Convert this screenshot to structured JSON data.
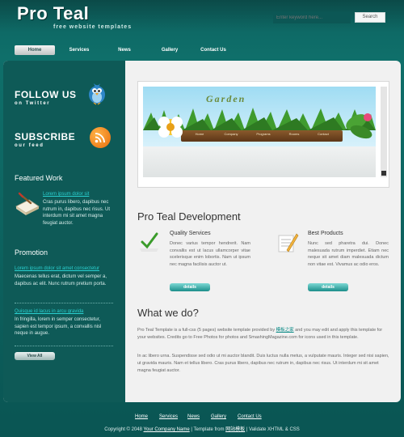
{
  "logo": {
    "title": "Pro Teal",
    "subtitle": "free website templates"
  },
  "search": {
    "placeholder": "Enter keyword here...",
    "button_label": "Search"
  },
  "nav": {
    "items": [
      "Home",
      "Services",
      "News",
      "Gallery",
      "Contact Us"
    ],
    "active": 0
  },
  "sidebar": {
    "twitter": {
      "title": "FOLLOW US",
      "subtitle": "on Twitter",
      "icon": "twitter-bird-icon"
    },
    "rss": {
      "title": "SUBSCRIBE",
      "subtitle": "our feed",
      "icon": "rss-icon"
    },
    "featured": {
      "title": "Featured Work",
      "link": "Lorem ipsum dolor sit",
      "text": "Cras purus libero, dapibus nec rutrum in, dapibus nec risus. Ut interdum mi sit amet magna feugiat auctor."
    },
    "promotion": {
      "title": "Promotion",
      "items": [
        {
          "link": "Lorem ipsum dolor sit amet consectetur",
          "text": "Maecenas tellus erat, dictum vel semper a, dapibus ac elit. Nunc rutrum pretium porta."
        },
        {
          "link": "Quisque id lacus in arcu gravida",
          "text": "In fringilla, lorem in semper consectetur, sapien est tempor ipsum, a convallis nisl neque in augue."
        }
      ],
      "view_all_label": "View All"
    }
  },
  "banner": {
    "word": "Garden",
    "menu": [
      "Home",
      "Company",
      "Programs",
      "Rooms",
      "Contact"
    ]
  },
  "main": {
    "heading": "Pro Teal Development",
    "features": [
      {
        "title": "Quality Services",
        "text": "Donec varius tempor hendrerit. Nam convallis est ut lacus ullamcorper vitae scelerisque enim lobortis. Nam ut ipsum nec magna facilisis auctor ut.",
        "button": "details"
      },
      {
        "title": "Best Products",
        "text": "Nunc sed pharetra dui. Donec malesuada rutrum imperdiet. Etiam nec neque sit amet diam malesuada dictum non vitae est. Vivamus ac odio eros.",
        "button": "details"
      }
    ],
    "sub_heading": "What we do?",
    "para1_prefix": "Pro Teal Template is a full-css (5 pages) website template provided by",
    "para1_link": "模板之家",
    "para1_suffix": "and you may edit and apply this template for your websites. Credits go to Free Photos for photos and SmashingMagazine.com for icons used in this template.",
    "para2": "In ac libero urna. Suspendisse sed odio ut mi auctor blandit. Duis luctus nulla metus, a vulputate mauris. Integer sed nisi sapien, ut gravida mauris. Nam et tellus libero. Cras purus libero, dapibus nec rutrum in, dapibus nec risus. Ut interdum mi sit amet magna feugiat auctor."
  },
  "footer": {
    "links": [
      "Home",
      "Services",
      "News",
      "Gallery",
      "Contact Us"
    ],
    "copyright_prefix": "Copyright © 2048",
    "company": "Your Company Name",
    "template_from_prefix": "| Template from",
    "template_source": "网站模板",
    "validate": "| Validate XHTML & CSS"
  },
  "colors": {
    "teal_dark": "#0e5a57",
    "teal_light": "#2ad0d0",
    "page_bg": "#f1f1f1"
  }
}
